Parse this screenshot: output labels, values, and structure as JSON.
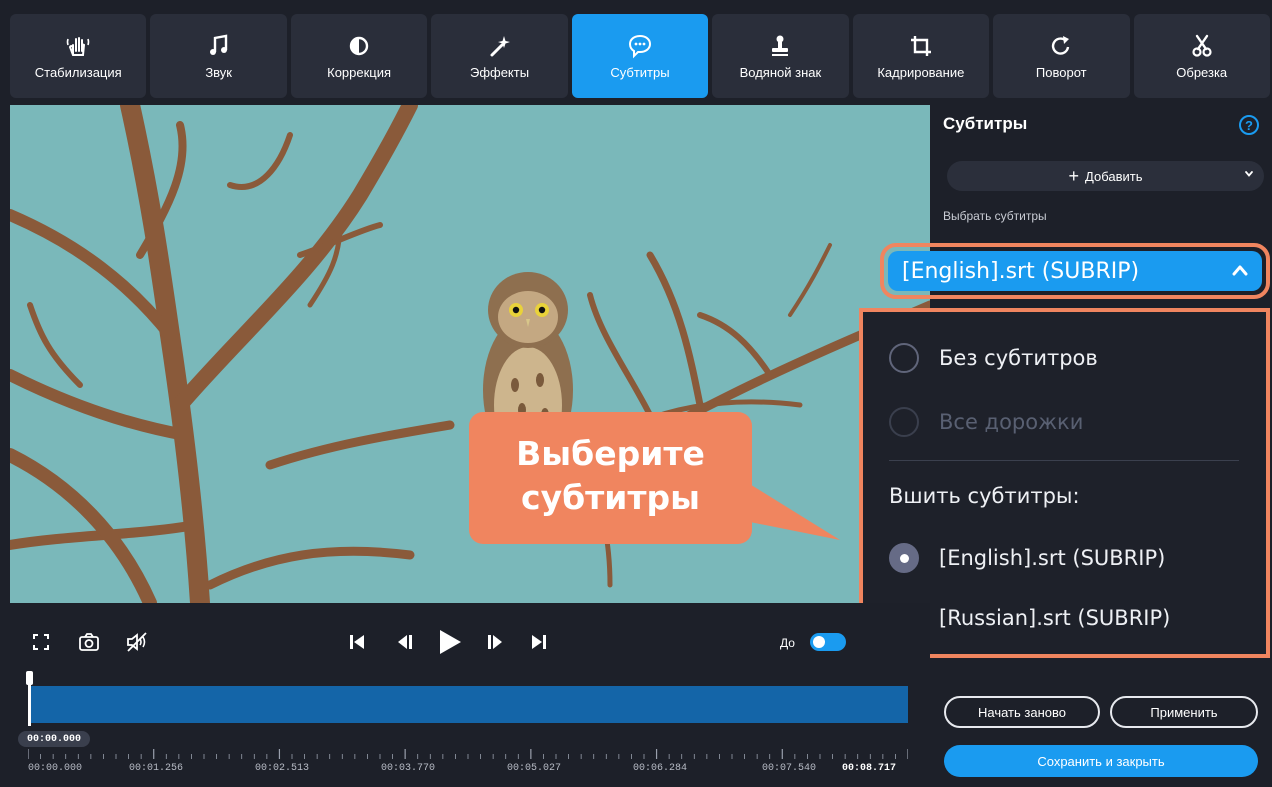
{
  "toolbar": {
    "tools": [
      {
        "label": "Стабилизация",
        "icon": "hand-stabilization-icon"
      },
      {
        "label": "Звук",
        "icon": "music-note-icon"
      },
      {
        "label": "Коррекция",
        "icon": "contrast-icon"
      },
      {
        "label": "Эффекты",
        "icon": "magic-wand-icon"
      },
      {
        "label": "Субтитры",
        "icon": "speech-bubble-icon",
        "active": true
      },
      {
        "label": "Водяной знак",
        "icon": "stamp-icon"
      },
      {
        "label": "Кадрирование",
        "icon": "crop-icon"
      },
      {
        "label": "Поворот",
        "icon": "rotate-icon"
      },
      {
        "label": "Обрезка",
        "icon": "scissors-icon"
      }
    ]
  },
  "panel": {
    "title": "Субтитры",
    "help": "?",
    "add_button": "Добавить",
    "choose_label": "Выбрать субтитры",
    "selected_subtitle": "[English].srt (SUBRIP)"
  },
  "dropdown": {
    "no_subtitles": "Без субтитров",
    "all_tracks": "Все дорожки",
    "burn_label": "Вшить субтитры:",
    "english": "[English].srt (SUBRIP)",
    "russian": "[Russian].srt (SUBRIP)"
  },
  "callout": {
    "line1": "Выберите",
    "line2": "субтитры"
  },
  "controls": {
    "before_label": "До"
  },
  "timeline": {
    "current_time": "00:00.000",
    "ticks": [
      "00:00.000",
      "00:01.256",
      "00:02.513",
      "00:03.770",
      "00:05.027",
      "00:06.284",
      "00:07.540"
    ],
    "end_time": "00:08.717"
  },
  "buttons": {
    "restart": "Начать заново",
    "apply": "Применить",
    "save_close": "Сохранить и закрыть"
  },
  "colors": {
    "accent": "#1a9bf0",
    "callout": "#f0855f",
    "background": "#1d2029"
  }
}
